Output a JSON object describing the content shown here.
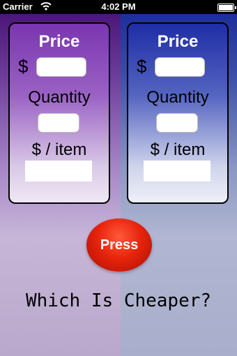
{
  "status_bar": {
    "carrier": "Carrier",
    "wifi_icon": "wifi-icon",
    "time": "4:02 PM",
    "battery_icon": "battery-icon"
  },
  "colors": {
    "left_panel": "#7a35b0",
    "right_panel": "#1f2da6",
    "button": "#e8240d"
  },
  "left_panel": {
    "title": "Price",
    "currency": "$",
    "price_value": "",
    "quantity_label": "Quantity",
    "quantity_value": "",
    "per_item_label": "$ / item",
    "per_item_value": ""
  },
  "right_panel": {
    "title": "Price",
    "currency": "$",
    "price_value": "",
    "quantity_label": "Quantity",
    "quantity_value": "",
    "per_item_label": "$ / item",
    "per_item_value": ""
  },
  "action": {
    "button_label": "Press"
  },
  "headline": "Which Is Cheaper?"
}
